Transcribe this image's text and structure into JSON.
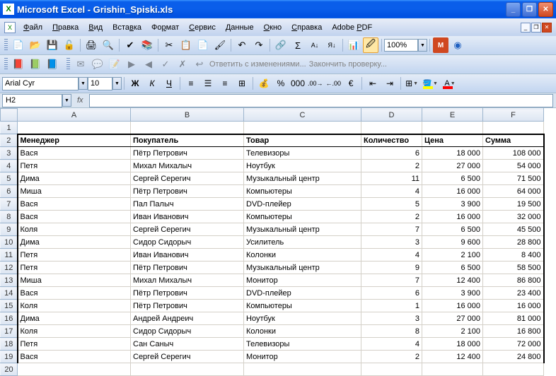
{
  "app": {
    "title": "Microsoft Excel - Grishin_Spiski.xls"
  },
  "menu": [
    "Файл",
    "Правка",
    "Вид",
    "Вставка",
    "Формат",
    "Сервис",
    "Данные",
    "Окно",
    "Справка",
    "Adobe PDF"
  ],
  "menu_underline": [
    0,
    0,
    0,
    4,
    2,
    0,
    0,
    0,
    0,
    6
  ],
  "review": {
    "reply": "Ответить с изменениями...",
    "end": "Закончить проверку..."
  },
  "format": {
    "font": "Arial Cyr",
    "size": "10",
    "euro": "€"
  },
  "zoom": "100%",
  "namebox": "H2",
  "fx": "fx",
  "columns": [
    "A",
    "B",
    "C",
    "D",
    "E",
    "F"
  ],
  "headers": {
    "A": "Менеджер",
    "B": "Покупатель",
    "C": "Товар",
    "D": "Количество",
    "E": "Цена",
    "F": "Сумма"
  },
  "chart_data": {
    "type": "table",
    "columns": [
      "Менеджер",
      "Покупатель",
      "Товар",
      "Количество",
      "Цена",
      "Сумма"
    ],
    "rows": [
      [
        "Вася",
        "Пётр Петрович",
        "Телевизоры",
        "6",
        "18 000",
        "108 000"
      ],
      [
        "Петя",
        "Михал Михалыч",
        "Ноутбук",
        "2",
        "27 000",
        "54 000"
      ],
      [
        "Дима",
        "Сергей Серегич",
        "Музыкальный центр",
        "11",
        "6 500",
        "71 500"
      ],
      [
        "Миша",
        "Пётр Петрович",
        "Компьютеры",
        "4",
        "16 000",
        "64 000"
      ],
      [
        "Вася",
        "Пал Палыч",
        "DVD-плейер",
        "5",
        "3 900",
        "19 500"
      ],
      [
        "Вася",
        "Иван Иванович",
        "Компьютеры",
        "2",
        "16 000",
        "32 000"
      ],
      [
        "Коля",
        "Сергей Серегич",
        "Музыкальный центр",
        "7",
        "6 500",
        "45 500"
      ],
      [
        "Дима",
        "Сидор Сидорыч",
        "Усилитель",
        "3",
        "9 600",
        "28 800"
      ],
      [
        "Петя",
        "Иван Иванович",
        "Колонки",
        "4",
        "2 100",
        "8 400"
      ],
      [
        "Петя",
        "Пётр Петрович",
        "Музыкальный центр",
        "9",
        "6 500",
        "58 500"
      ],
      [
        "Миша",
        "Михал Михалыч",
        "Монитор",
        "7",
        "12 400",
        "86 800"
      ],
      [
        "Вася",
        "Пётр Петрович",
        "DVD-плейер",
        "6",
        "3 900",
        "23 400"
      ],
      [
        "Коля",
        "Пётр Петрович",
        "Компьютеры",
        "1",
        "16 000",
        "16 000"
      ],
      [
        "Дима",
        "Андрей Андреич",
        "Ноутбук",
        "3",
        "27 000",
        "81 000"
      ],
      [
        "Коля",
        "Сидор Сидорыч",
        "Колонки",
        "8",
        "2 100",
        "16 800"
      ],
      [
        "Петя",
        "Сан Саныч",
        "Телевизоры",
        "4",
        "18 000",
        "72 000"
      ],
      [
        "Вася",
        "Сергей Серегич",
        "Монитор",
        "2",
        "12 400",
        "24 800"
      ]
    ]
  }
}
